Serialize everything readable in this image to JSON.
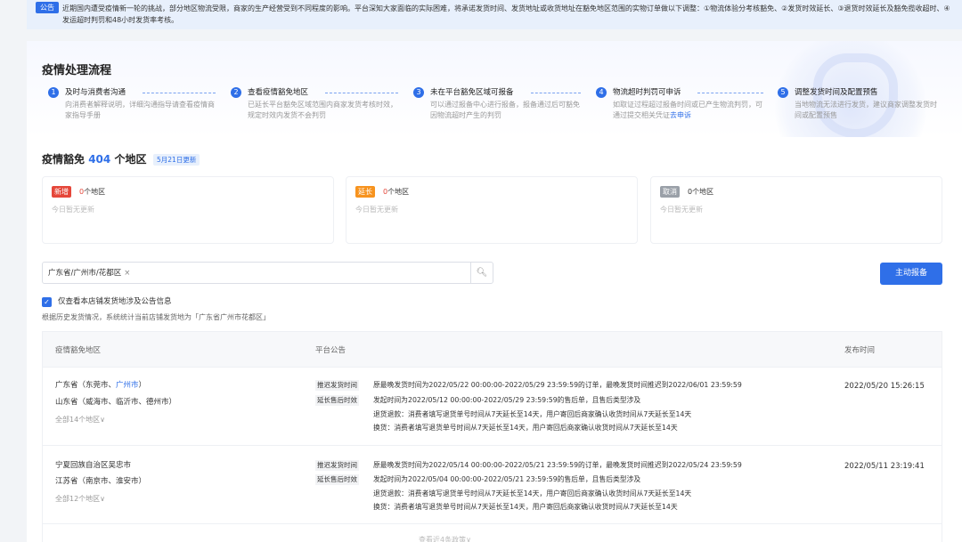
{
  "notice": {
    "badge": "公告",
    "text": "近期国内遭受疫情新一轮的挑战，部分地区物流受限，商家的生产经营受到不同程度的影响。平台深知大家面临的实际困难，将承诺发货时间、发货地址或收货地址在豁免地区范围的实物订单做以下调整：①物流体验分考核豁免、②发货时效延长、③退货时效延长及豁免揽收超时、④发运超时判罚和48小时发货率考核。"
  },
  "process": {
    "title": "疫情处理流程",
    "steps": [
      {
        "num": "1",
        "title": "及时与消费者沟通",
        "desc": "向消费者解释说明，详细沟通指导请查看疫情商家指导手册",
        "link": ""
      },
      {
        "num": "2",
        "title": "查看疫情豁免地区",
        "desc": "已延长平台豁免区域范围内商家发货考核时效，规定时效内发货不会判罚",
        "link": ""
      },
      {
        "num": "3",
        "title": "未在平台豁免区域可报备",
        "desc": "可以通过报备中心进行报备，报备通过后可豁免因物流超时产生的判罚",
        "link": ""
      },
      {
        "num": "4",
        "title": "物流超时判罚可申诉",
        "desc": "如取证过程超过报备时间或已产生物流判罚，可通过提交相关凭证",
        "link": "去申诉"
      },
      {
        "num": "5",
        "title": "调整发货时间及配置预售",
        "desc": "当地物流无法进行发货，建议商家调整发货时间或配置预售",
        "link": ""
      }
    ]
  },
  "exempt": {
    "title_prefix": "疫情豁免",
    "count": "404",
    "title_suffix": "个地区",
    "update": "5月21日更新",
    "cards": [
      {
        "tag": "新增",
        "color": "#e5473a",
        "count": "0",
        "unit": "个地区",
        "note": "今日暂无更新"
      },
      {
        "tag": "延长",
        "color": "#f7931e",
        "count": "0",
        "unit": "个地区",
        "note": "今日暂无更新"
      },
      {
        "tag": "取消",
        "color": "#9aa0a8",
        "count": "0",
        "unit": "个地区",
        "note": "今日暂无更新"
      }
    ]
  },
  "filter": {
    "chip": "广东省/广州市/花都区",
    "chip_close": "×",
    "search_icon": "search-icon",
    "report_button": "主动报备",
    "checkbox_label": "仅查看本店铺发货地涉及公告信息",
    "stat_text": "根据历史发货情况，系统统计当前店铺发货地为「广东省广州市花都区」"
  },
  "table": {
    "headers": [
      "疫情豁免地区",
      "平台公告",
      "发布时间"
    ],
    "rows": [
      {
        "region1_prov": "广东省（东莞市、",
        "region1_hl": "广州市",
        "region1_end": "）",
        "region2": "山东省（威海市、临沂市、德州市）",
        "more": "全部14个地区∨",
        "tag1": "推迟发货时间",
        "text1": "原最晚发货时间为2022/05/22 00:00:00-2022/05/29 23:59:59的订单，最晚发货时间推迟到2022/06/01 23:59:59",
        "tag2": "延长售后时效",
        "text2": "发起时间为2022/05/12 00:00:00-2022/05/29 23:59:59的售后单，且售后类型涉及",
        "text3": "退货退款：消费者填写退货单号时间从7天延长至14天，用户寄回后商家确认收货时间从7天延长至14天",
        "text4": "换货：消费者填写退货单号时间从7天延长至14天，用户寄回后商家确认收货时间从7天延长至14天",
        "date": "2022/05/20 15:26:15"
      },
      {
        "region1_prov": "宁夏回族自治区吴忠市",
        "region1_hl": "",
        "region1_end": "",
        "region2": "江苏省（南京市、淮安市）",
        "more": "全部12个地区∨",
        "tag1": "推迟发货时间",
        "text1": "原最晚发货时间为2022/05/14 00:00:00-2022/05/21 23:59:59的订单，最晚发货时间推迟到2022/05/24 23:59:59",
        "tag2": "延长售后时效",
        "text2": "发起时间为2022/05/04 00:00:00-2022/05/21 23:59:59的售后单，且售后类型涉及",
        "text3": "退货退款：消费者填写退货单号时间从7天延长至14天，用户寄回后商家确认收货时间从7天延长至14天",
        "text4": "换货：消费者填写退货单号时间从7天延长至14天，用户寄回后商家确认收货时间从7天延长至14天",
        "date": "2022/05/11 23:19:41"
      }
    ],
    "more_link": "查看近4条政策∨"
  }
}
